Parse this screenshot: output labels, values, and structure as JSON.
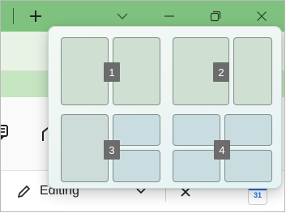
{
  "title_bar": {
    "new_tab_symbol": "+",
    "icons": [
      "plus-icon",
      "chevron-down-icon",
      "minimize-icon",
      "restore-icon",
      "close-icon"
    ],
    "color": "#7fc27f"
  },
  "background_app": {
    "toolbar_icons": [
      "comment-icon",
      "home-icon",
      "pencil-icon",
      "chevron-down-icon",
      "close-icon",
      "google-calendar-icon"
    ],
    "editing_label": "Editing",
    "calendar_day": "31"
  },
  "snap_flyout": {
    "layouts": [
      {
        "badge": "1",
        "zones": 2
      },
      {
        "badge": "2",
        "zones": 2
      },
      {
        "badge": "3",
        "zones": 3
      },
      {
        "badge": "4",
        "zones": 4
      }
    ]
  }
}
